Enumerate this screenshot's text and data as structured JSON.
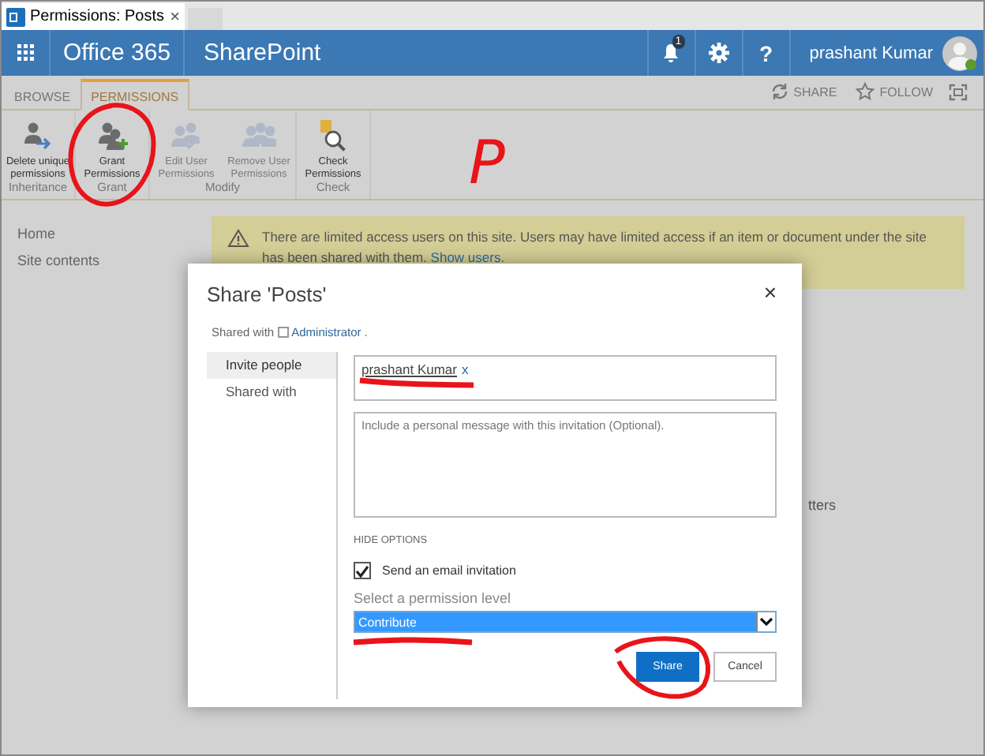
{
  "browser_tab": {
    "title": "Permissions: Posts",
    "close": "×"
  },
  "suite_bar": {
    "brand": "Office 365",
    "app": "SharePoint",
    "notifications": "1",
    "help": "?",
    "user": "prashant Kumar"
  },
  "ribbon": {
    "tabs": [
      {
        "label": "BROWSE",
        "selected": false
      },
      {
        "label": "PERMISSIONS",
        "selected": true
      }
    ],
    "actions": [
      {
        "label": "SHARE"
      },
      {
        "label": "FOLLOW"
      }
    ],
    "groups": [
      {
        "label": "Inheritance",
        "buttons": [
          {
            "label": "Delete unique permissions",
            "disabled": false
          }
        ]
      },
      {
        "label": "Grant",
        "buttons": [
          {
            "label": "Grant Permissions",
            "disabled": false
          }
        ]
      },
      {
        "label": "Modify",
        "buttons": [
          {
            "label": "Edit User Permissions",
            "disabled": true
          },
          {
            "label": "Remove User Permissions",
            "disabled": true
          }
        ]
      },
      {
        "label": "Check",
        "buttons": [
          {
            "label": "Check Permissions",
            "disabled": false
          }
        ]
      }
    ]
  },
  "nav": [
    "Home",
    "Site contents"
  ],
  "banner": {
    "text": "There are limited access users on this site. Users may have limited access if an item or document under the site has been shared with them.",
    "link": "Show users."
  },
  "background_text": "tters",
  "handwritten_mark": "P",
  "dialog": {
    "title": "Share 'Posts'",
    "close": "×",
    "shared_with_label": "Shared with",
    "shared_with_user": "Administrator",
    "shared_with_suffix": ".",
    "tabs": [
      {
        "label": "Invite people",
        "selected": true
      },
      {
        "label": "Shared with",
        "selected": false
      }
    ],
    "people": [
      {
        "name": "prashant Kumar",
        "remove": "x"
      }
    ],
    "message_placeholder": "Include a personal message with this invitation (Optional).",
    "options_toggle": "HIDE OPTIONS",
    "email_invitation": {
      "label": "Send an email invitation",
      "checked": true
    },
    "permission_label": "Select a permission level",
    "permission_value": "Contribute",
    "buttons": [
      {
        "label": "Share",
        "kind": "primary"
      },
      {
        "label": "Cancel",
        "kind": "secondary"
      }
    ]
  }
}
